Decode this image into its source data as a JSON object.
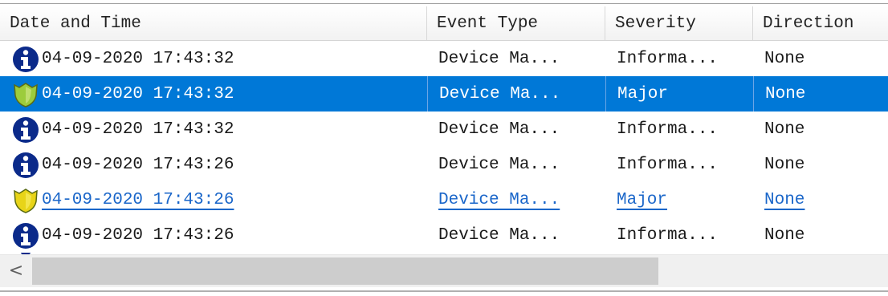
{
  "columns": [
    {
      "label": "Date and Time"
    },
    {
      "label": "Event Type"
    },
    {
      "label": "Severity"
    },
    {
      "label": "Direction"
    }
  ],
  "rows": [
    {
      "icon": "info-icon",
      "datetime": "04-09-2020 17:43:32",
      "event_type": "Device Ma...",
      "severity": "Informa...",
      "direction": "None",
      "state": "normal"
    },
    {
      "icon": "shield-major-icon",
      "datetime": "04-09-2020 17:43:32",
      "event_type": "Device Ma...",
      "severity": "Major",
      "direction": "None",
      "state": "selected"
    },
    {
      "icon": "info-icon",
      "datetime": "04-09-2020 17:43:32",
      "event_type": "Device Ma...",
      "severity": "Informa...",
      "direction": "None",
      "state": "normal"
    },
    {
      "icon": "info-icon",
      "datetime": "04-09-2020 17:43:26",
      "event_type": "Device Ma...",
      "severity": "Informa...",
      "direction": "None",
      "state": "normal"
    },
    {
      "icon": "shield-major-icon",
      "datetime": "04-09-2020 17:43:26",
      "event_type": "Device Ma...",
      "severity": "Major",
      "direction": "None",
      "state": "hot"
    },
    {
      "icon": "info-icon",
      "datetime": "04-09-2020 17:43:26",
      "event_type": "Device Ma...",
      "severity": "Informa...",
      "direction": "None",
      "state": "normal"
    }
  ],
  "scrollbar": {
    "left_arrow": "<"
  },
  "colors": {
    "selection": "#0078d7",
    "hot_link": "#1a66c9",
    "info_icon": "#0b2a8a",
    "shield_major": "#9ccc3c"
  }
}
